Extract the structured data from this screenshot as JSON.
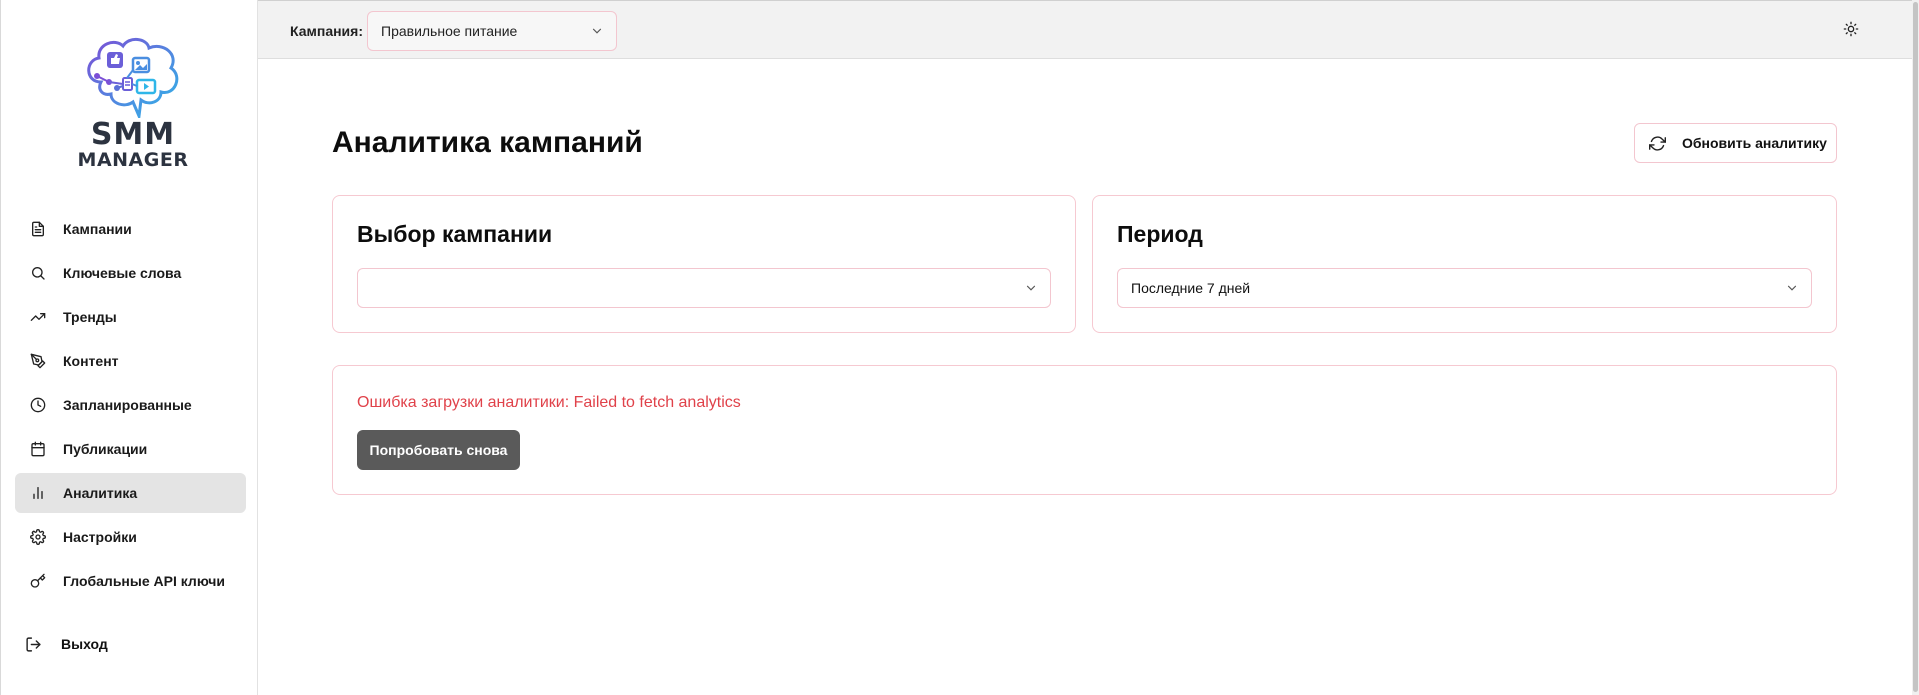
{
  "sidebar": {
    "logo": {
      "line1": "SMM",
      "line2": "MANAGER"
    },
    "items": [
      {
        "label": "Кампании",
        "icon": "file-text-icon",
        "active": false
      },
      {
        "label": "Ключевые слова",
        "icon": "search-icon",
        "active": false
      },
      {
        "label": "Тренды",
        "icon": "trending-up-icon",
        "active": false
      },
      {
        "label": "Контент",
        "icon": "pen-tool-icon",
        "active": false
      },
      {
        "label": "Запланированные",
        "icon": "clock-icon",
        "active": false
      },
      {
        "label": "Публикации",
        "icon": "calendar-icon",
        "active": false
      },
      {
        "label": "Аналитика",
        "icon": "bar-chart-icon",
        "active": true
      },
      {
        "label": "Настройки",
        "icon": "gear-icon",
        "active": false
      },
      {
        "label": "Глобальные API ключи",
        "icon": "key-icon",
        "active": false
      }
    ],
    "logout": {
      "label": "Выход",
      "icon": "log-out-icon"
    }
  },
  "topbar": {
    "campaign_label": "Кампания:",
    "campaign_value": "Правильное питание",
    "theme_icon": "sun-icon"
  },
  "main": {
    "title": "Аналитика кампаний",
    "refresh_label": "Обновить аналитику",
    "campaign_card": {
      "title": "Выбор кампании",
      "value": ""
    },
    "period_card": {
      "title": "Период",
      "value": "Последние 7 дней"
    },
    "error": {
      "message": "Ошибка загрузки аналитики: Failed to fetch analytics",
      "retry_label": "Попробовать снова"
    }
  },
  "colors": {
    "accent_border": "#f3c6cf",
    "error_text": "#e0424a",
    "active_nav_bg": "#e4e4e4",
    "retry_bg": "#5a5a5a"
  }
}
